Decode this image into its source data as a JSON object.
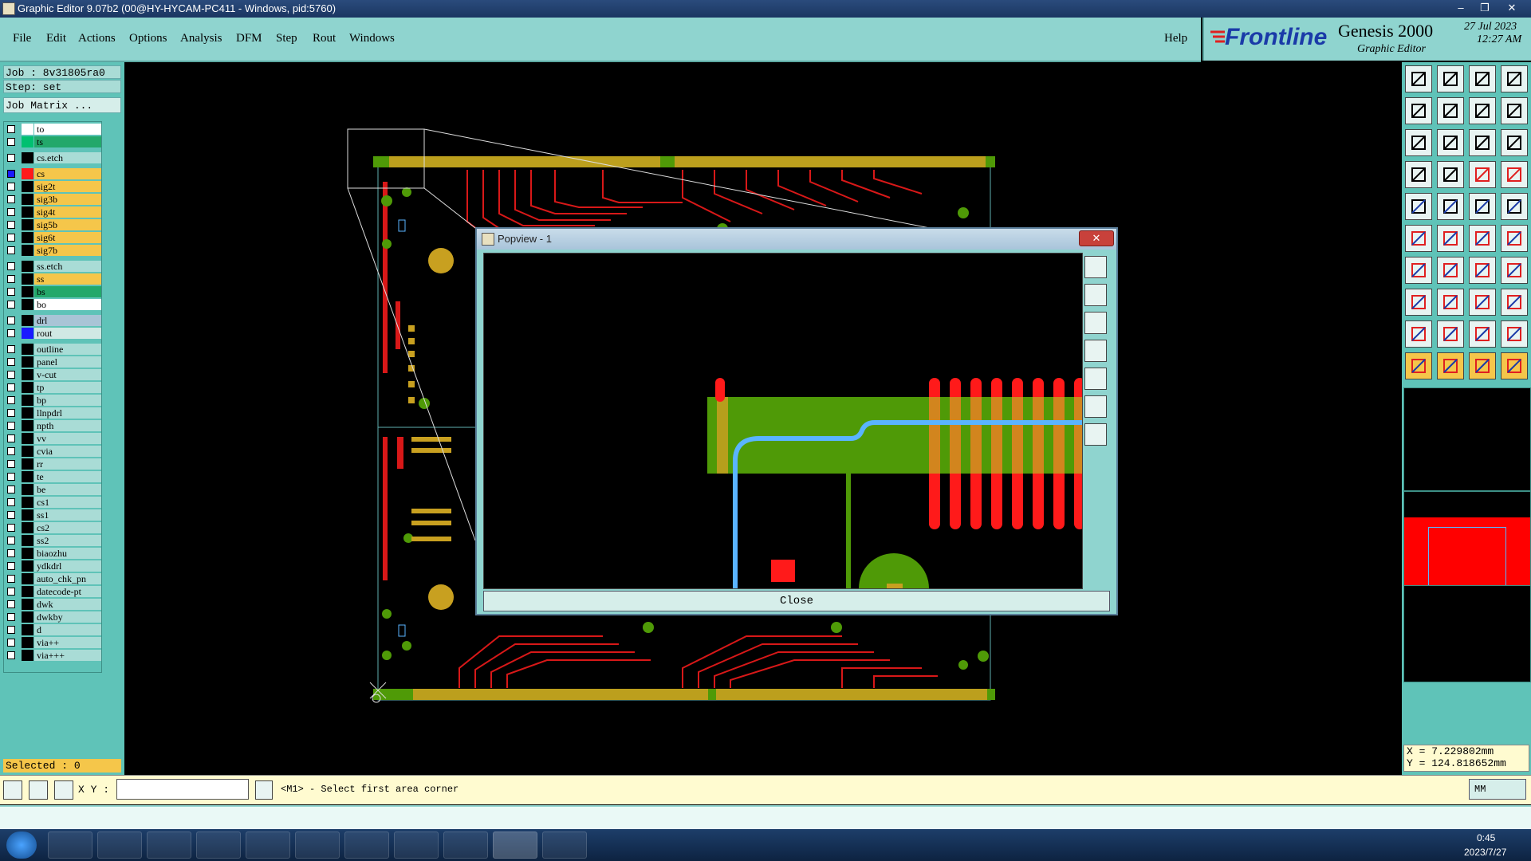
{
  "window": {
    "title": "Graphic Editor 9.07b2 (00@HY-HYCAM-PC411 - Windows, pid:5760)"
  },
  "menu": {
    "items": [
      "File",
      "Edit",
      "Actions",
      "Options",
      "Analysis",
      "DFM",
      "Step",
      "Rout",
      "Windows"
    ],
    "help": "Help"
  },
  "brand": {
    "logo": "Frontline",
    "product": "Genesis 2000",
    "subtitle": "Graphic Editor",
    "date": "27 Jul 2023",
    "time": "12:27 AM"
  },
  "job": {
    "job_line": "Job : 8v31805ra0",
    "step_line": "Step: set",
    "matrix_button": "Job Matrix ..."
  },
  "layers": [
    {
      "name": "to",
      "color": "#ffffff",
      "bg": "#ffffff"
    },
    {
      "name": "ts",
      "color": "#00c070",
      "bg": "#23a86a"
    },
    {
      "name": "cs.etch",
      "color": "#000000",
      "bg": "#a9dcd6"
    },
    {
      "name": "cs",
      "color": "#ff1a1a",
      "bg": "#f5c64a",
      "active": true
    },
    {
      "name": "sig2t",
      "color": "#000000",
      "bg": "#f5c64a"
    },
    {
      "name": "sig3b",
      "color": "#000000",
      "bg": "#f5c64a"
    },
    {
      "name": "sig4t",
      "color": "#000000",
      "bg": "#f5c64a"
    },
    {
      "name": "sig5b",
      "color": "#000000",
      "bg": "#f5c64a"
    },
    {
      "name": "sig6t",
      "color": "#000000",
      "bg": "#f5c64a"
    },
    {
      "name": "sig7b",
      "color": "#000000",
      "bg": "#f5c64a"
    },
    {
      "name": "ss.etch",
      "color": "#000000",
      "bg": "#a9dcd6"
    },
    {
      "name": "ss",
      "color": "#000000",
      "bg": "#f5c64a"
    },
    {
      "name": "bs",
      "color": "#000000",
      "bg": "#23a86a"
    },
    {
      "name": "bo",
      "color": "#000000",
      "bg": "#ffffff"
    },
    {
      "name": "drl",
      "color": "#000000",
      "bg": "#a9c4d6"
    },
    {
      "name": "rout",
      "color": "#1a1aff",
      "bg": "#d0e8e4"
    },
    {
      "name": "outline",
      "color": "#000000",
      "bg": "#a9dcd6"
    },
    {
      "name": "panel",
      "color": "#000000",
      "bg": "#a9dcd6"
    },
    {
      "name": "v-cut",
      "color": "#000000",
      "bg": "#a9dcd6"
    },
    {
      "name": "tp",
      "color": "#000000",
      "bg": "#a9dcd6"
    },
    {
      "name": "bp",
      "color": "#000000",
      "bg": "#a9dcd6"
    },
    {
      "name": "llnpdrl",
      "color": "#000000",
      "bg": "#a9dcd6"
    },
    {
      "name": "npth",
      "color": "#000000",
      "bg": "#a9dcd6"
    },
    {
      "name": "vv",
      "color": "#000000",
      "bg": "#a9dcd6"
    },
    {
      "name": "cvia",
      "color": "#000000",
      "bg": "#a9dcd6"
    },
    {
      "name": "rr",
      "color": "#000000",
      "bg": "#a9dcd6"
    },
    {
      "name": "te",
      "color": "#000000",
      "bg": "#a9dcd6"
    },
    {
      "name": "be",
      "color": "#000000",
      "bg": "#a9dcd6"
    },
    {
      "name": "cs1",
      "color": "#000000",
      "bg": "#a9dcd6"
    },
    {
      "name": "ss1",
      "color": "#000000",
      "bg": "#a9dcd6"
    },
    {
      "name": "cs2",
      "color": "#000000",
      "bg": "#a9dcd6"
    },
    {
      "name": "ss2",
      "color": "#000000",
      "bg": "#a9dcd6"
    },
    {
      "name": "biaozhu",
      "color": "#000000",
      "bg": "#a9dcd6"
    },
    {
      "name": "ydkdrl",
      "color": "#000000",
      "bg": "#a9dcd6"
    },
    {
      "name": "auto_chk_pn",
      "color": "#000000",
      "bg": "#a9dcd6"
    },
    {
      "name": "datecode-pt",
      "color": "#000000",
      "bg": "#a9dcd6"
    },
    {
      "name": "dwk",
      "color": "#000000",
      "bg": "#a9dcd6"
    },
    {
      "name": "dwkby",
      "color": "#000000",
      "bg": "#a9dcd6"
    },
    {
      "name": "d",
      "color": "#000000",
      "bg": "#a9dcd6"
    },
    {
      "name": "via++",
      "color": "#000000",
      "bg": "#a9dcd6"
    },
    {
      "name": "via+++",
      "color": "#000000",
      "bg": "#a9dcd6"
    }
  ],
  "selected": "Selected : 0",
  "coords": {
    "x": "X = 7.229802mm",
    "y": "Y = 124.818652mm"
  },
  "command": {
    "xy_label": "X Y :",
    "xy_value": "",
    "prompt": "<M1> - Select first area corner",
    "units": "MM"
  },
  "popview": {
    "title": "Popview - 1",
    "close_x": "✕",
    "close_button": "Close"
  },
  "taskbar": {
    "time": "0:45",
    "date": "2023/7/27"
  },
  "colors": {
    "pcb_green": "#4f9a07",
    "trace_red": "#ff1a1a",
    "pad_gold": "#c8a020",
    "rout_blue": "#5ab4ff",
    "panel_teal": "#5fc3b8"
  }
}
